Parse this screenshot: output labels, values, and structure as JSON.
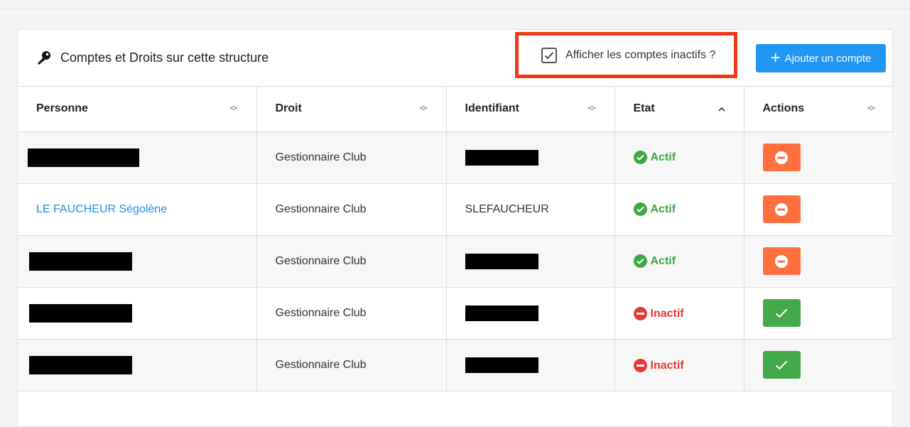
{
  "panel": {
    "title": "Comptes et Droits sur cette structure",
    "title_icon": "key-icon",
    "show_inactive": {
      "label": "Afficher les comptes inactifs ?",
      "checked": true
    },
    "add_button": {
      "label": "Ajouter un compte",
      "icon": "plus-icon"
    }
  },
  "table": {
    "columns": [
      {
        "label": "Personne",
        "sort": "none"
      },
      {
        "label": "Droit",
        "sort": "none"
      },
      {
        "label": "Identifiant",
        "sort": "none"
      },
      {
        "label": "Etat",
        "sort": "asc"
      },
      {
        "label": "Actions",
        "sort": "none"
      }
    ],
    "rows": [
      {
        "person": "",
        "person_redacted": true,
        "role": "Gestionnaire Club",
        "login": "",
        "login_redacted": true,
        "status": "Actif",
        "action": "deactivate"
      },
      {
        "person": "LE FAUCHEUR Ségolène",
        "person_redacted": false,
        "role": "Gestionnaire Club",
        "login": "SLEFAUCHEUR",
        "login_redacted": false,
        "status": "Actif",
        "action": "deactivate"
      },
      {
        "person": "",
        "person_redacted": true,
        "role": "Gestionnaire Club",
        "login": "",
        "login_redacted": true,
        "status": "Actif",
        "action": "deactivate"
      },
      {
        "person": "",
        "person_redacted": true,
        "role": "Gestionnaire Club",
        "login": "",
        "login_redacted": true,
        "status": "Inactif",
        "action": "activate"
      },
      {
        "person": "",
        "person_redacted": true,
        "role": "Gestionnaire Club",
        "login": "",
        "login_redacted": true,
        "status": "Inactif",
        "action": "activate"
      }
    ]
  },
  "colors": {
    "accent": "#2196f3",
    "active": "#3fa845",
    "inactive": "#e53935",
    "deactivate_button": "#ff6f3f",
    "activate_button": "#43a94a",
    "highlight_box": "#f03a17"
  }
}
